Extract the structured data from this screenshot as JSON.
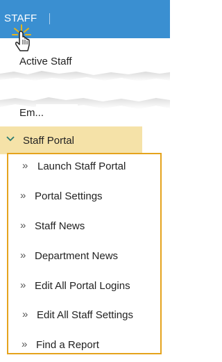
{
  "topbar": {
    "tab_label": "STAFF"
  },
  "menu": {
    "active_staff": "Active Staff",
    "partial_item": "Em...",
    "staff_portal": "Staff Portal"
  },
  "submenu": {
    "items": [
      {
        "label": "Launch Staff Portal"
      },
      {
        "label": "Portal Settings"
      },
      {
        "label": "Staff News"
      },
      {
        "label": "Department News"
      },
      {
        "label": "Edit All Portal Logins"
      },
      {
        "label": "Edit All Staff Settings"
      },
      {
        "label": "Find a Report"
      }
    ]
  },
  "icons": {
    "expand": "chevron-down-icon",
    "subitem": "double-chevron-right-icon",
    "cursor": "hand-pointer-icon"
  },
  "colors": {
    "topbar": "#3a8fd1",
    "highlight": "#f5e2a8",
    "border": "#e5a31c"
  }
}
